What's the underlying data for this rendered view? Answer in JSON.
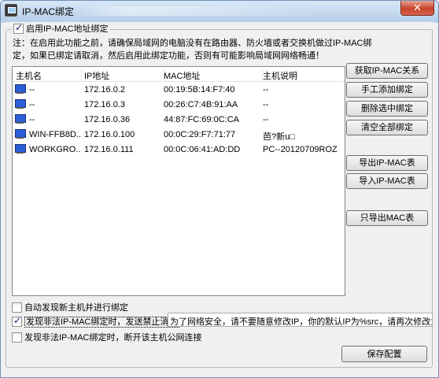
{
  "window": {
    "title": "IP-MAC绑定",
    "close_glyph": "✕"
  },
  "enable": {
    "label": "启用IP-MAC地址绑定",
    "checked": true
  },
  "note": {
    "line1": "注：在启用此功能之前，请确保局域网的电脑没有在路由器、防火墙或者交换机做过IP-MAC绑",
    "line2": "定，如果已绑定请取消，然后启用此绑定功能，否则有可能影响局域网网络畅通！"
  },
  "table": {
    "columns": [
      "主机名",
      "IP地址",
      "MAC地址",
      "主机说明"
    ],
    "rows": [
      {
        "host": "--",
        "ip": "172.16.0.2",
        "mac": "00:19:5B:14:F7:40",
        "desc": "--"
      },
      {
        "host": "--",
        "ip": "172.16.0.3",
        "mac": "00:26:C7:4B:91:AA",
        "desc": "--"
      },
      {
        "host": "--",
        "ip": "172.16.0.36",
        "mac": "44:87:FC:69:0C:CA",
        "desc": "--"
      },
      {
        "host": "WIN-FFB8D...",
        "ip": "172.16.0.100",
        "mac": "00:0C:29:F7:71:77",
        "desc": "芭?新u□"
      },
      {
        "host": "WORKGRO...",
        "ip": "172.16.0.111",
        "mac": "00:0C:06:41:AD:DD",
        "desc": "PC--20120709ROZ"
      }
    ]
  },
  "buttons": {
    "get": "获取IP-MAC关系",
    "manual_add": "手工添加绑定",
    "delete_selected": "删除选中绑定",
    "clear_all": "清空全部绑定",
    "export": "导出IP-MAC表",
    "import": "导入IP-MAC表",
    "export_mac_only": "只导出MAC表",
    "save": "保存配置"
  },
  "options": {
    "auto_bind": {
      "label": "自动发现新主机并进行绑定",
      "checked": false
    },
    "send_block": {
      "label": "发现非法IP-MAC绑定时，发送禁止消息",
      "checked": true
    },
    "disconnect": {
      "label": "发现非法IP-MAC绑定时，断开该主机公网连接",
      "checked": false
    }
  },
  "warning_message": "为了网络安全，请不要随意修改IP，你的默认IP为%src，请再次修改为默"
}
